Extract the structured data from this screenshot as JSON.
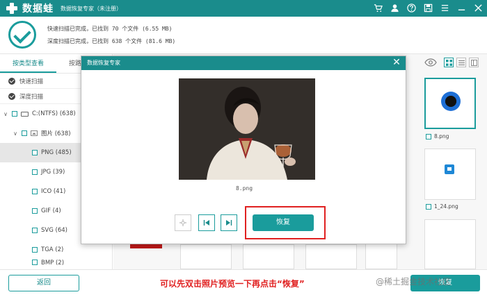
{
  "titlebar": {
    "brand": "数据蛙",
    "app_title": "数据恢复专家（未注册）",
    "icons": [
      "cart-icon",
      "user-icon",
      "help-icon",
      "save-icon",
      "menu-icon",
      "minimize-icon",
      "close-icon"
    ]
  },
  "summary": {
    "quick_scan": "快速扫描已完成，已找到 70 个文件 (6.55 MB)",
    "deep_scan": "深度扫描已完成，已找到 638 个文件 (81.6 MB)"
  },
  "tabs": [
    "按类型查看",
    "按路"
  ],
  "scan_options": [
    "快速扫描",
    "深度扫描"
  ],
  "tree": [
    {
      "label": "C:(NTFS) (638)",
      "level": 0
    },
    {
      "label": "图片 (638)",
      "level": 1
    },
    {
      "label": "PNG (485)",
      "level": 2,
      "selected": true
    },
    {
      "label": "JPG (39)",
      "level": 2
    },
    {
      "label": "ICO (41)",
      "level": 2
    },
    {
      "label": "GIF (4)",
      "level": 2
    },
    {
      "label": "SVG (64)",
      "level": 2
    },
    {
      "label": "TGA (2)",
      "level": 2
    },
    {
      "label": "BMP (2)",
      "level": 2
    }
  ],
  "grid": {
    "card_labels": [
      "8.png",
      "1_24.png"
    ],
    "partial_label": "g"
  },
  "dialog": {
    "title": "数据恢复专家",
    "photo_name": "8.png",
    "recover_label": "恢复"
  },
  "bottom": {
    "back_label": "返回",
    "hint": "可以先双击照片预览一下再点击“恢复”",
    "recover_label": "恢复",
    "watermark": "@稀土掘金技术社区"
  },
  "colors": {
    "accent": "#1a9c9c",
    "titlebar": "#1a8c8c",
    "highlight": "#e02020"
  }
}
